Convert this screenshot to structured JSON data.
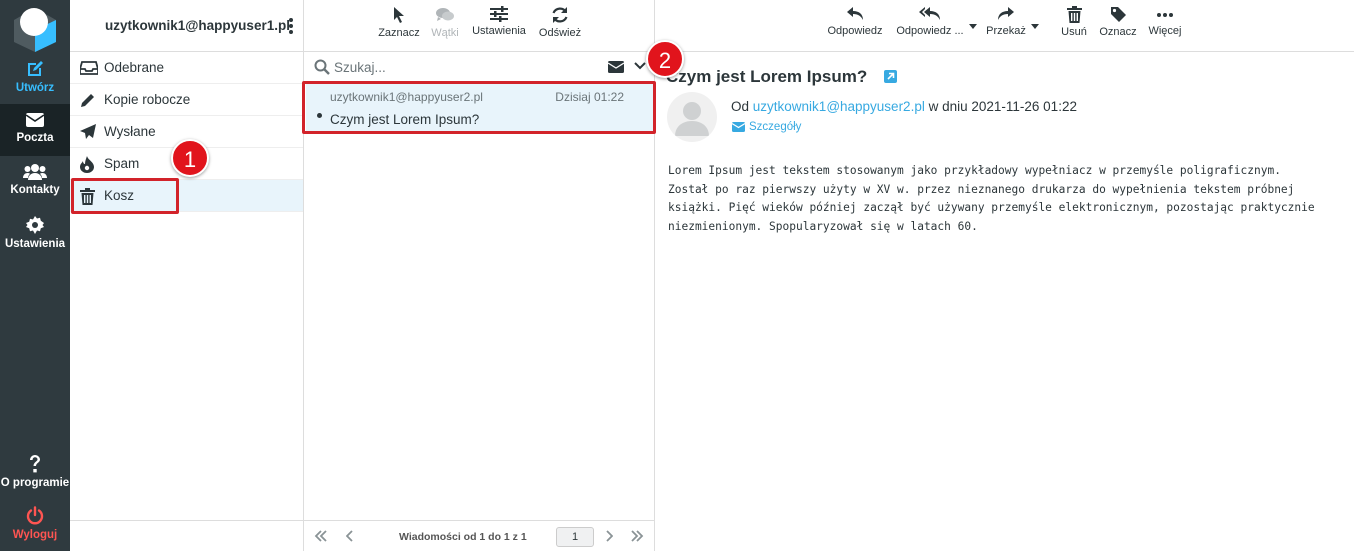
{
  "nav": {
    "compose": "Utwórz",
    "mail": "Poczta",
    "contacts": "Kontakty",
    "settings": "Ustawienia",
    "about": "O programie",
    "logout": "Wyloguj"
  },
  "account": "uzytkownik1@happyuser1.pl",
  "folders": [
    {
      "label": "Odebrane",
      "icon": "inbox-icon"
    },
    {
      "label": "Kopie robocze",
      "icon": "pencil-icon"
    },
    {
      "label": "Wysłane",
      "icon": "paper-plane-icon"
    },
    {
      "label": "Spam",
      "icon": "fire-icon"
    },
    {
      "label": "Kosz",
      "icon": "trash-icon",
      "selected": true
    }
  ],
  "list_toolbar": {
    "select": "Zaznacz",
    "threads": "Wątki",
    "settings": "Ustawienia",
    "refresh": "Odśwież"
  },
  "search": {
    "placeholder": "Szukaj..."
  },
  "message": {
    "from": "uzytkownik1@happyuser2.pl",
    "date": "Dzisiaj 01:22",
    "subject": "Czym jest Lorem Ipsum?"
  },
  "pager": {
    "text": "Wiadomości od 1 do 1 z 1",
    "page": "1"
  },
  "reader_toolbar": {
    "reply": "Odpowiedz",
    "reply_all": "Odpowiedz ...",
    "forward": "Przekaż",
    "delete": "Usuń",
    "mark": "Oznacz",
    "more": "Więcej"
  },
  "mail": {
    "subject": "Czym jest Lorem Ipsum?",
    "from_prefix": "Od",
    "from_address": "uzytkownik1@happyuser2.pl",
    "date_text": "w dniu 2021-11-26 01:22",
    "details": "Szczegóły",
    "body": [
      "Lorem Ipsum jest tekstem stosowanym jako przykładowy wypełniacz w przemyśle poligraficznym.",
      "Został po raz pierwszy użyty w XV w. przez nieznanego drukarza do wypełnienia tekstem próbnej",
      "książki. Pięć wieków później zaczął być używany przemyśle elektronicznym, pozostając praktycznie",
      "niezmienionym. Spopularyzował się w latach 60."
    ]
  },
  "annotations": {
    "badge1": "1",
    "badge2": "2"
  },
  "colors": {
    "nav_bg": "#2f3a3f",
    "accent": "#37beff",
    "highlight": "#e8f4fb",
    "callout": "#d2232a",
    "logout": "#ff5552"
  }
}
